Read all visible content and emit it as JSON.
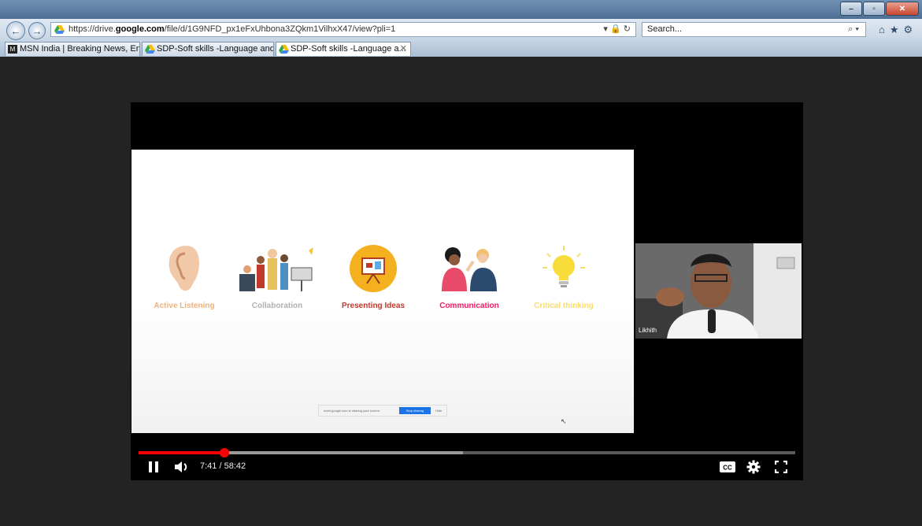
{
  "browser": {
    "url_prefix": "https://drive.",
    "url_domain": "google.com",
    "url_path": "/file/d/1G9NFD_px1eFxUhbona3ZQkm1VilhxX47/view?pli=1",
    "search_placeholder": "Search...",
    "tabs": [
      {
        "label": "MSN India | Breaking News, En...",
        "icon": "msn-icon",
        "active": false
      },
      {
        "label": "SDP-Soft skills -Language and ...",
        "icon": "google-drive-icon",
        "active": false
      },
      {
        "label": "SDP-Soft skills -Language a...",
        "icon": "google-drive-icon",
        "active": true
      }
    ]
  },
  "slide": {
    "skills": [
      {
        "label": "Active Listening",
        "color": "#f0b27a"
      },
      {
        "label": "Collaboration",
        "color": "#b0b0b0"
      },
      {
        "label": "Presenting Ideas",
        "color": "#c0392b"
      },
      {
        "label": "Communication",
        "color": "#e91e63"
      },
      {
        "label": "Critical thinking",
        "color": "#f7dc6f"
      }
    ],
    "share_text": "meet.google.com is sharing your screen.",
    "stop_sharing_label": "Stop sharing",
    "hide_label": "Hide"
  },
  "webcam": {
    "name": "Likhith"
  },
  "player": {
    "time_current": "7:41",
    "time_total": "58:42",
    "time_separator": " / ",
    "played_fraction": 0.131,
    "buffered_fraction": 0.494,
    "cc_label": "CC"
  }
}
